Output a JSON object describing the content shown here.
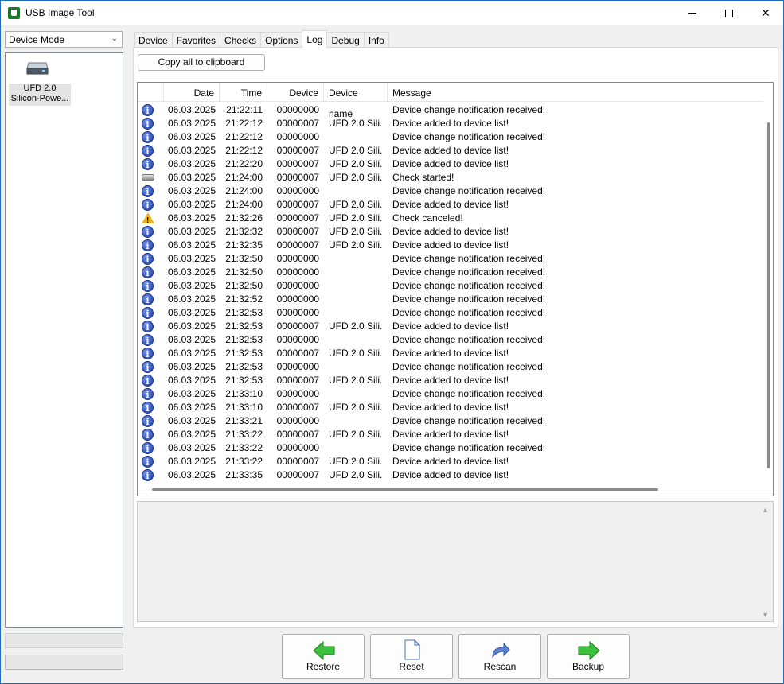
{
  "window": {
    "title": "USB Image Tool",
    "minimize_label": "–",
    "maximize_label": "□",
    "close_label": "✕"
  },
  "sidebar": {
    "mode_select": "Device Mode",
    "device": {
      "name_line1": "UFD 2.0",
      "name_line2": "Silicon-Powe...",
      "icon": "drive-icon"
    }
  },
  "tabs": [
    "Device",
    "Favorites",
    "Checks",
    "Options",
    "Log",
    "Debug",
    "Info"
  ],
  "active_tab": "Log",
  "log": {
    "copy_button": "Copy all to clipboard",
    "columns": [
      "Date",
      "Time",
      "Device",
      "Device name",
      "Message"
    ],
    "rows": [
      {
        "icon": "info",
        "date": "06.03.2025",
        "time": "21:22:11",
        "device": "00000000",
        "name": "",
        "message": "Device change notification received!"
      },
      {
        "icon": "info",
        "date": "06.03.2025",
        "time": "21:22:12",
        "device": "00000007",
        "name": "UFD 2.0 Sili...",
        "message": "Device added to device list!"
      },
      {
        "icon": "info",
        "date": "06.03.2025",
        "time": "21:22:12",
        "device": "00000000",
        "name": "",
        "message": "Device change notification received!"
      },
      {
        "icon": "info",
        "date": "06.03.2025",
        "time": "21:22:12",
        "device": "00000007",
        "name": "UFD 2.0 Sili...",
        "message": "Device added to device list!"
      },
      {
        "icon": "info",
        "date": "06.03.2025",
        "time": "21:22:20",
        "device": "00000007",
        "name": "UFD 2.0 Sili...",
        "message": "Device added to device list!"
      },
      {
        "icon": "drive",
        "date": "06.03.2025",
        "time": "21:24:00",
        "device": "00000007",
        "name": "UFD 2.0 Sili...",
        "message": "Check started!"
      },
      {
        "icon": "info",
        "date": "06.03.2025",
        "time": "21:24:00",
        "device": "00000000",
        "name": "",
        "message": "Device change notification received!"
      },
      {
        "icon": "info",
        "date": "06.03.2025",
        "time": "21:24:00",
        "device": "00000007",
        "name": "UFD 2.0 Sili...",
        "message": "Device added to device list!"
      },
      {
        "icon": "warn",
        "date": "06.03.2025",
        "time": "21:32:26",
        "device": "00000007",
        "name": "UFD 2.0 Sili...",
        "message": "Check canceled!"
      },
      {
        "icon": "info",
        "date": "06.03.2025",
        "time": "21:32:32",
        "device": "00000007",
        "name": "UFD 2.0 Sili...",
        "message": "Device added to device list!"
      },
      {
        "icon": "info",
        "date": "06.03.2025",
        "time": "21:32:35",
        "device": "00000007",
        "name": "UFD 2.0 Sili...",
        "message": "Device added to device list!"
      },
      {
        "icon": "info",
        "date": "06.03.2025",
        "time": "21:32:50",
        "device": "00000000",
        "name": "",
        "message": "Device change notification received!"
      },
      {
        "icon": "info",
        "date": "06.03.2025",
        "time": "21:32:50",
        "device": "00000000",
        "name": "",
        "message": "Device change notification received!"
      },
      {
        "icon": "info",
        "date": "06.03.2025",
        "time": "21:32:50",
        "device": "00000000",
        "name": "",
        "message": "Device change notification received!"
      },
      {
        "icon": "info",
        "date": "06.03.2025",
        "time": "21:32:52",
        "device": "00000000",
        "name": "",
        "message": "Device change notification received!"
      },
      {
        "icon": "info",
        "date": "06.03.2025",
        "time": "21:32:53",
        "device": "00000000",
        "name": "",
        "message": "Device change notification received!"
      },
      {
        "icon": "info",
        "date": "06.03.2025",
        "time": "21:32:53",
        "device": "00000007",
        "name": "UFD 2.0 Sili...",
        "message": "Device added to device list!"
      },
      {
        "icon": "info",
        "date": "06.03.2025",
        "time": "21:32:53",
        "device": "00000000",
        "name": "",
        "message": "Device change notification received!"
      },
      {
        "icon": "info",
        "date": "06.03.2025",
        "time": "21:32:53",
        "device": "00000007",
        "name": "UFD 2.0 Sili...",
        "message": "Device added to device list!"
      },
      {
        "icon": "info",
        "date": "06.03.2025",
        "time": "21:32:53",
        "device": "00000000",
        "name": "",
        "message": "Device change notification received!"
      },
      {
        "icon": "info",
        "date": "06.03.2025",
        "time": "21:32:53",
        "device": "00000007",
        "name": "UFD 2.0 Sili...",
        "message": "Device added to device list!"
      },
      {
        "icon": "info",
        "date": "06.03.2025",
        "time": "21:33:10",
        "device": "00000000",
        "name": "",
        "message": "Device change notification received!"
      },
      {
        "icon": "info",
        "date": "06.03.2025",
        "time": "21:33:10",
        "device": "00000007",
        "name": "UFD 2.0 Sili...",
        "message": "Device added to device list!"
      },
      {
        "icon": "info",
        "date": "06.03.2025",
        "time": "21:33:21",
        "device": "00000000",
        "name": "",
        "message": "Device change notification received!"
      },
      {
        "icon": "info",
        "date": "06.03.2025",
        "time": "21:33:22",
        "device": "00000007",
        "name": "UFD 2.0 Sili...",
        "message": "Device added to device list!"
      },
      {
        "icon": "info",
        "date": "06.03.2025",
        "time": "21:33:22",
        "device": "00000000",
        "name": "",
        "message": "Device change notification received!"
      },
      {
        "icon": "info",
        "date": "06.03.2025",
        "time": "21:33:22",
        "device": "00000007",
        "name": "UFD 2.0 Sili...",
        "message": "Device added to device list!"
      },
      {
        "icon": "info",
        "date": "06.03.2025",
        "time": "21:33:35",
        "device": "00000007",
        "name": "UFD 2.0 Sili...",
        "message": "Device added to device list!"
      }
    ]
  },
  "actions": {
    "restore": {
      "label": "Restore",
      "icon": "arrow-left-green-icon"
    },
    "reset": {
      "label": "Reset",
      "icon": "document-icon"
    },
    "rescan": {
      "label": "Rescan",
      "icon": "refresh-arrow-icon"
    },
    "backup": {
      "label": "Backup",
      "icon": "arrow-right-green-icon"
    }
  },
  "colors": {
    "accent_border": "#1e6fc4",
    "info_icon": "#1f3fa8",
    "warn_icon": "#e8b31e",
    "action_arrow": "#3cc23c"
  }
}
